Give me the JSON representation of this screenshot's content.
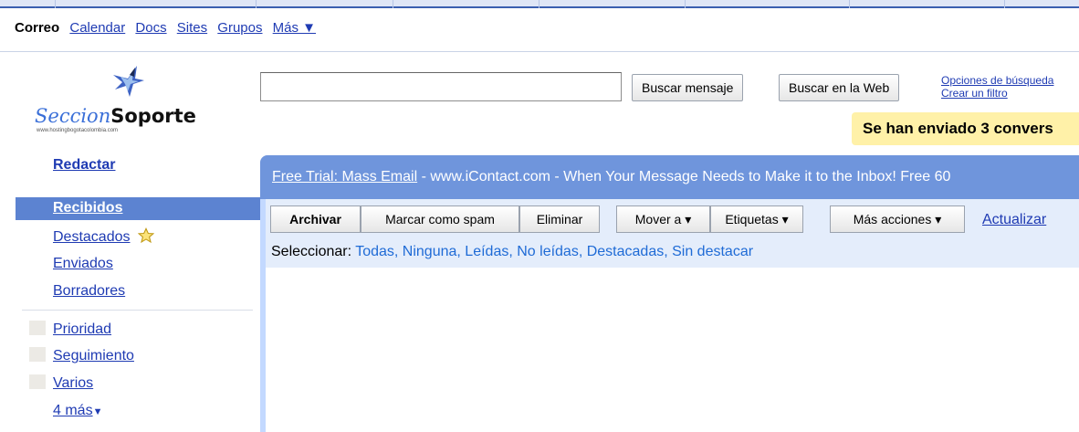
{
  "nav": {
    "current": "Correo",
    "links": [
      "Calendar",
      "Docs",
      "Sites",
      "Grupos"
    ],
    "more": "Más ▼"
  },
  "logo": {
    "text_a": "Seccion",
    "text_b": "Soporte",
    "subtitle": "www.hostingbogotacolombia.com"
  },
  "search": {
    "input_value": "",
    "search_mail_label": "Buscar mensaje",
    "search_web_label": "Buscar en la Web",
    "options_link": "Opciones de búsqueda",
    "create_filter_link": "Crear un filtro"
  },
  "notice": {
    "text": "Se han enviado 3 convers"
  },
  "sidebar": {
    "compose": "Redactar",
    "inbox": "Recibidos",
    "items": [
      "Destacados",
      "Enviados",
      "Borradores"
    ],
    "labels": [
      "Prioridad",
      "Seguimiento",
      "Varios"
    ],
    "more_labels": "4 más"
  },
  "ad": {
    "link": "Free Trial: Mass Email",
    "text": " - www.iContact.com - When Your Message Needs to Make it to the Inbox! Free 60"
  },
  "toolbar": {
    "archive": "Archivar",
    "spam": "Marcar como spam",
    "delete": "Eliminar",
    "move": "Mover a ▾",
    "labels": "Etiquetas ▾",
    "more_actions": "Más acciones ▾",
    "refresh": "Actualizar"
  },
  "select": {
    "label": "Seleccionar:",
    "options": [
      "Todas",
      "Ninguna",
      "Leídas",
      "No leídas",
      "Destacadas",
      "Sin destacar"
    ]
  },
  "colors": {
    "link": "#1f3bb3",
    "inbox_bar": "#5c83d1",
    "ad_band": "#6f95dc",
    "panel": "#c3d9ff",
    "notice": "#fff1a8"
  }
}
